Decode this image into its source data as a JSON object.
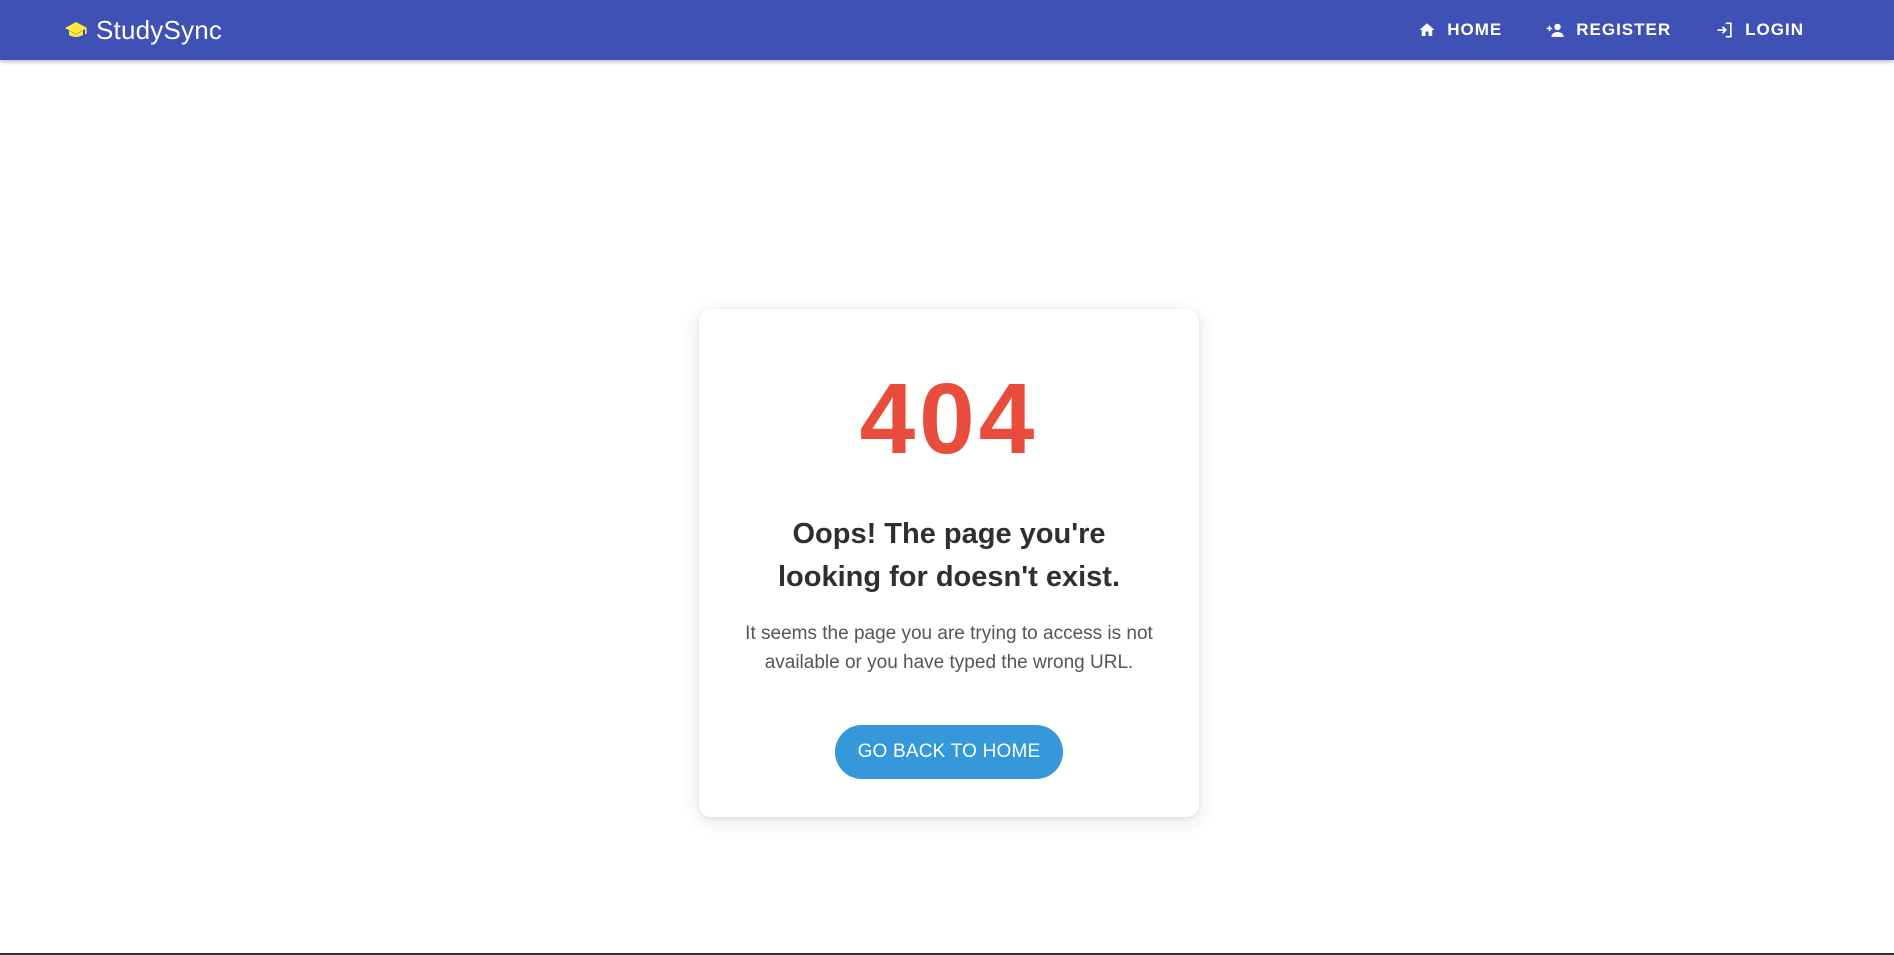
{
  "app": {
    "brand_name": "StudySync",
    "brand_icon": "graduation-cap-icon",
    "brand_icon_color": "#ffeb3b"
  },
  "nav": {
    "items": [
      {
        "label": "HOME",
        "icon": "home-icon"
      },
      {
        "label": "REGISTER",
        "icon": "person-add-icon"
      },
      {
        "label": "LOGIN",
        "icon": "login-icon"
      }
    ]
  },
  "error": {
    "code": "404",
    "title": "Oops! The page you're looking for doesn't exist.",
    "description": "It seems the page you are trying to access is not available or you have typed the wrong URL.",
    "button_label": "GO BACK TO HOME"
  },
  "colors": {
    "appbar": "#3f51b5",
    "error_code": "#e74c3c",
    "button": "#3498db"
  }
}
